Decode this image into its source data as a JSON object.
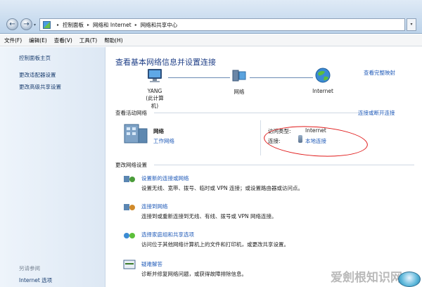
{
  "nav": {
    "back": "←",
    "forward": "→",
    "dropdown": "▾"
  },
  "address": {
    "crumbs": [
      "控制面板",
      "网络和 Internet",
      "网络和共享中心"
    ],
    "separator": "▸"
  },
  "menu": [
    "文件(F)",
    "编辑(E)",
    "查看(V)",
    "工具(T)",
    "帮助(H)"
  ],
  "sidebar": {
    "items": [
      "控制面板主页",
      "更改适配器设置",
      "更改高级共享设置"
    ],
    "see_also": "另请参阅",
    "bottom_items": [
      "Internet 选项"
    ]
  },
  "main": {
    "title": "查看基本网络信息并设置连接",
    "full_map": "查看完整映射",
    "nodes": {
      "computer": [
        "YANG",
        "(此计算机)"
      ],
      "network": "网络",
      "internet": "Internet"
    },
    "active_label": "查看活动网络",
    "connect_disconnect": "连接或断开连接",
    "network": {
      "name": "网络",
      "type": "工作网络"
    },
    "access_type_key": "访问类型:",
    "access_type_val": "Internet",
    "connection_key": "连接:",
    "connection_val": "本地连接",
    "change_label": "更改网络设置",
    "tasks": [
      {
        "title": "设置新的连接或网络",
        "desc": "设置无线、宽带、拨号、临时或 VPN 连接；或设置路由器或访问点。"
      },
      {
        "title": "连接到网络",
        "desc": "连接到或重新连接到无线、有线、拨号或 VPN 网络连接。"
      },
      {
        "title": "选择家庭组和共享选项",
        "desc": "访问位于其他网络计算机上的文件和打印机，或更改共享设置。"
      },
      {
        "title": "疑难解答",
        "desc": "诊断并修复网络问题，或获得故障排除信息。"
      }
    ]
  },
  "watermark": "爱劍根知识网",
  "colors": {
    "link": "#1f5ab8",
    "title": "#1f3f87",
    "highlight": "#e01818"
  }
}
